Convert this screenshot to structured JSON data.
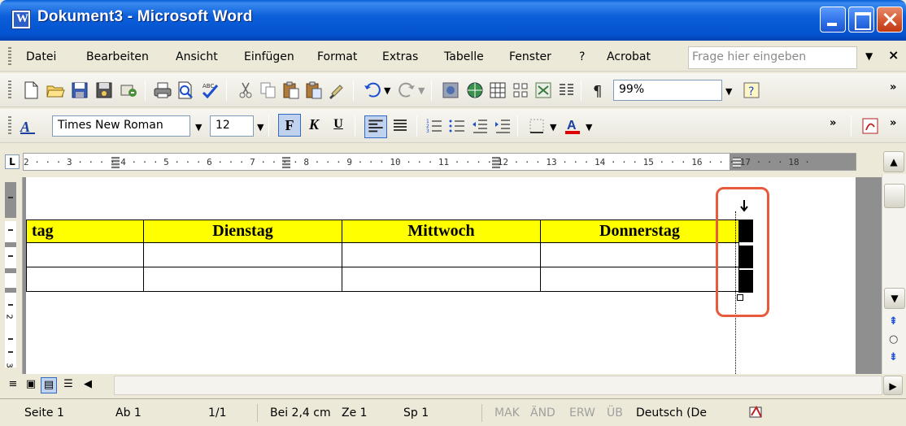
{
  "window": {
    "title": "Dokument3 - Microsoft Word",
    "icon": "word-document-icon"
  },
  "menu": {
    "items": [
      "Datei",
      "Bearbeiten",
      "Ansicht",
      "Einfügen",
      "Format",
      "Extras",
      "Tabelle",
      "Fenster",
      "?",
      "Acrobat"
    ],
    "help_placeholder": "Frage hier eingeben"
  },
  "standard_toolbar": {
    "zoom": "99%"
  },
  "format_toolbar": {
    "font": "Times New Roman",
    "size": "12",
    "bold_label": "F",
    "italic_label": "K",
    "underline_label": "U",
    "font_color": "#e00000"
  },
  "ruler": {
    "labels": "2 · · · 3 · · · · 4 · · · 5 · · · 6 · · · 7 · · · · 8 · · · 9 · · · 10 · · · 11 · · · · 12 · · · 13 · · · 14 · · · 15 · · · 16 · · · 17 · · · 18 ·"
  },
  "table": {
    "headers": [
      "tag",
      "Dienstag",
      "Mittwoch",
      "Donnerstag"
    ],
    "header_color": "#ffff00",
    "rows": [
      [
        "",
        "",
        "",
        ""
      ],
      [
        "",
        "",
        "",
        ""
      ]
    ]
  },
  "annotation": {
    "color": "#e85a3c"
  },
  "status": {
    "page": "Seite 1",
    "section": "Ab 1",
    "pages": "1/1",
    "position": "Bei 2,4 cm",
    "line": "Ze 1",
    "column": "Sp 1",
    "mak": "MAK",
    "aend": "ÄND",
    "erw": "ERW",
    "ueb": "ÜB",
    "language": "Deutsch (De"
  }
}
